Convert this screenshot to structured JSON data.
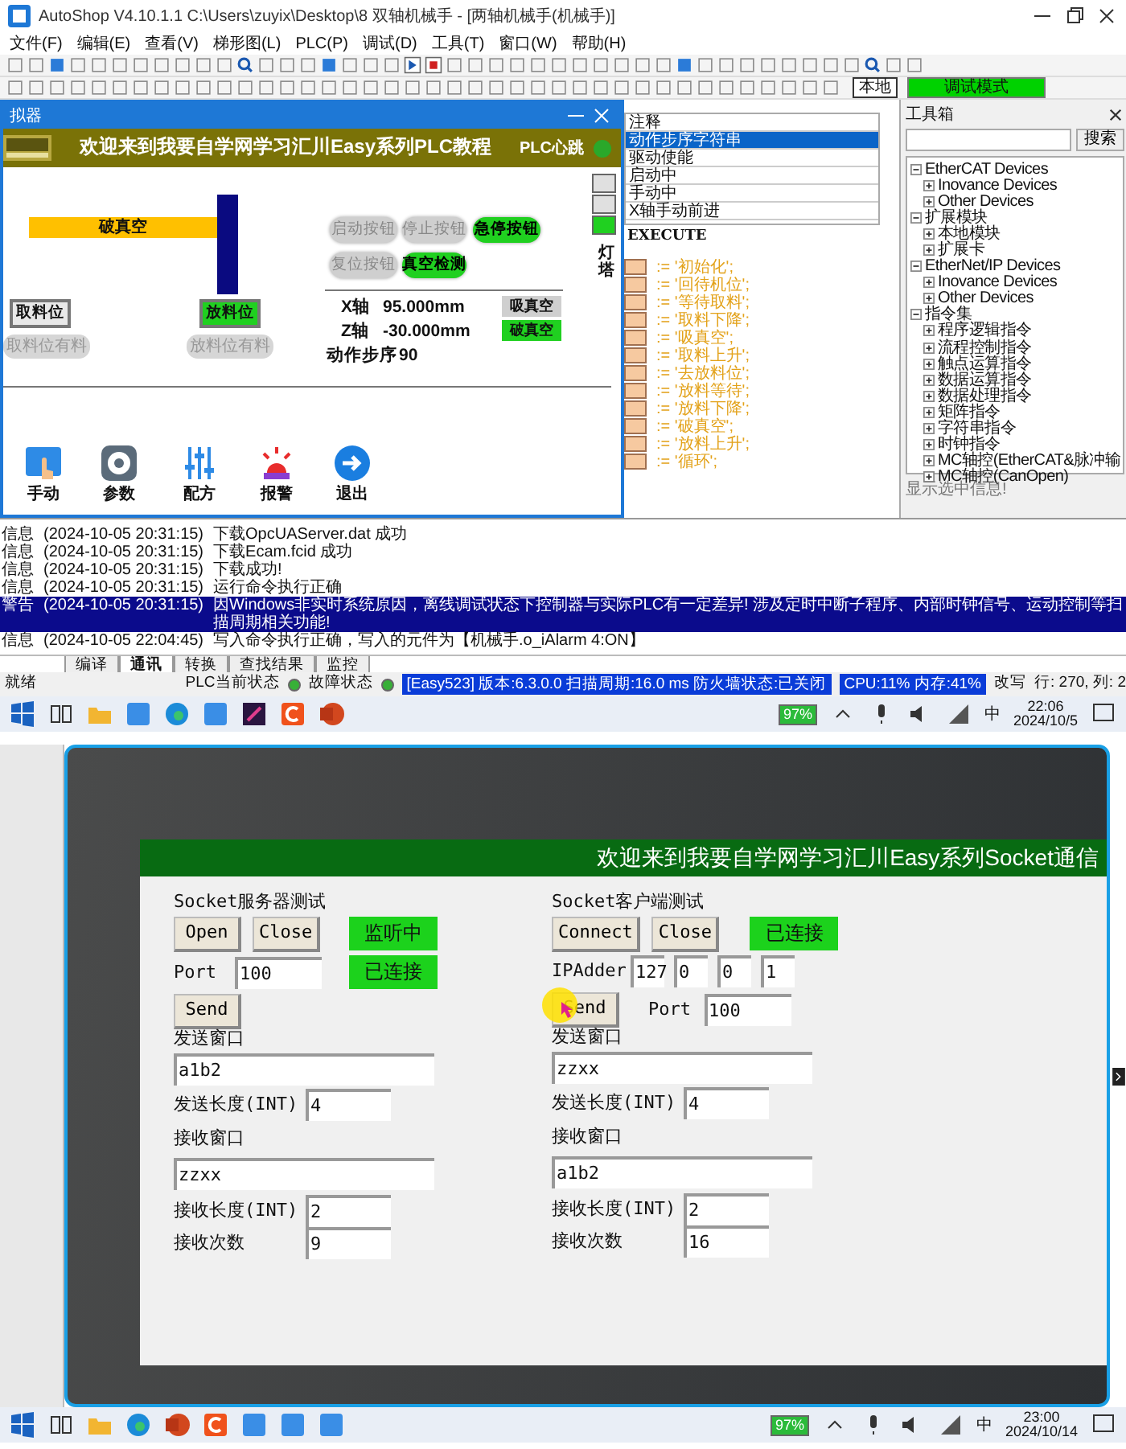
{
  "top": {
    "window": {
      "title": "AutoShop V4.10.1.1  C:\\Users\\zuyix\\Desktop\\8 双轴机械手 - [两轴机械手(机械手)]"
    },
    "menu": [
      "文件(F)",
      "编辑(E)",
      "查看(V)",
      "梯形图(L)",
      "PLC(P)",
      "调试(D)",
      "工具(T)",
      "窗口(W)",
      "帮助(H)"
    ],
    "toolbar": {
      "location": "本地",
      "mode": "调试模式"
    },
    "simulator": {
      "title": "拟器",
      "header": "欢迎来到我要自学网学习汇川Easy系列PLC教程",
      "heartbeat_label": "PLC心跳",
      "heartbeat_on": true,
      "vacuum_bar": "破真空",
      "buttons": [
        {
          "label": "启动按钮",
          "on": false
        },
        {
          "label": "停止按钮",
          "on": false
        },
        {
          "label": "急停按钮",
          "on": true
        },
        {
          "label": "复位按钮",
          "on": false
        },
        {
          "label": "真空检测",
          "on": true
        }
      ],
      "positions": [
        {
          "label": "取料位",
          "on": false
        },
        {
          "label": "放料位",
          "on": true
        }
      ],
      "sensors": [
        {
          "label": "取料位有料",
          "on": false
        },
        {
          "label": "放料位有料",
          "on": false
        }
      ],
      "axes": [
        {
          "label": "X轴",
          "value": "95.000mm"
        },
        {
          "label": "Z轴",
          "value": "-30.000mm"
        }
      ],
      "step": {
        "label": "动作步序",
        "value": "90"
      },
      "vacuum": [
        {
          "label": "吸真空",
          "on": false
        },
        {
          "label": "破真空",
          "on": true
        }
      ],
      "tower": {
        "label": "灯塔",
        "lamps": [
          {
            "on": false
          },
          {
            "on": false
          },
          {
            "on": true
          }
        ]
      },
      "nav": [
        {
          "label": "手动",
          "kind": "hand"
        },
        {
          "label": "参数",
          "kind": "gear"
        },
        {
          "label": "配方",
          "kind": "sliders"
        },
        {
          "label": "报警",
          "kind": "siren"
        },
        {
          "label": "退出",
          "kind": "exit"
        }
      ]
    },
    "variables": [
      {
        "text": "注释",
        "selected": false
      },
      {
        "text": "动作步序字符串",
        "selected": true
      },
      {
        "text": "驱动使能",
        "selected": false
      },
      {
        "text": "启动中",
        "selected": false
      },
      {
        "text": "手动中",
        "selected": false
      },
      {
        "text": "X轴手动前进",
        "selected": false
      }
    ],
    "code": {
      "label": "EXECUTE",
      "lines": [
        ":= '初始化';",
        ":= '回待机位';",
        ":= '等待取料';",
        ":= '取料下降';",
        ":= '吸真空';",
        ":= '取料上升';",
        ":= '去放料位';",
        ":= '放料等待';",
        ":= '放料下降';",
        ":= '破真空';",
        ":= '放料上升';",
        ":= '循环';"
      ]
    },
    "toolbox": {
      "title": "工具箱",
      "search_button": "搜索",
      "tree": [
        {
          "text": "EtherCAT Devices",
          "expanded": true,
          "children": [
            {
              "text": "Inovance Devices",
              "expanded": false
            },
            {
              "text": "Other Devices",
              "expanded": false
            }
          ]
        },
        {
          "text": "扩展模块",
          "expanded": true,
          "children": [
            {
              "text": "本地模块",
              "expanded": false
            },
            {
              "text": "扩展卡",
              "expanded": false
            }
          ]
        },
        {
          "text": "EtherNet/IP Devices",
          "expanded": true,
          "children": [
            {
              "text": "Inovance Devices",
              "expanded": false
            },
            {
              "text": "Other Devices",
              "expanded": false
            }
          ]
        },
        {
          "text": "指令集",
          "expanded": true,
          "children": [
            {
              "text": "程序逻辑指令",
              "expanded": false
            },
            {
              "text": "流程控制指令",
              "expanded": false
            },
            {
              "text": "触点运算指令",
              "expanded": false
            },
            {
              "text": "数据运算指令",
              "expanded": false
            },
            {
              "text": "数据处理指令",
              "expanded": false
            },
            {
              "text": "矩阵指令",
              "expanded": false
            },
            {
              "text": "字符串指令",
              "expanded": false
            },
            {
              "text": "时钟指令",
              "expanded": false
            },
            {
              "text": "MC轴控(EtherCAT&脉冲输",
              "expanded": false
            },
            {
              "text": "MC轴控(CanOpen)",
              "expanded": false
            }
          ]
        }
      ],
      "info": "显示选中信息!"
    },
    "log": {
      "lines": [
        {
          "type": "信息",
          "time": "(2024-10-05 20:31:15)",
          "message": "下载OpcUAServer.dat 成功",
          "selected": false
        },
        {
          "type": "信息",
          "time": "(2024-10-05 20:31:15)",
          "message": "下载Ecam.fcid 成功",
          "selected": false
        },
        {
          "type": "信息",
          "time": "(2024-10-05 20:31:15)",
          "message": "下载成功!",
          "selected": false
        },
        {
          "type": "信息",
          "time": "(2024-10-05 20:31:15)",
          "message": "运行命令执行正确",
          "selected": false
        },
        {
          "type": "警告",
          "time": "(2024-10-05 20:31:15)",
          "message": "因Windows非实时系统原因，离线调试状态下控制器与实际PLC有一定差异! 涉及定时中断子程序、内部时钟信号、运动控制等扫描周期相关功能!",
          "selected": true
        },
        {
          "type": "信息",
          "time": "(2024-10-05 22:04:45)",
          "message": "写入命令执行正确，写入的元件为【机械手.o_iAlarm 4:ON】",
          "selected": false
        }
      ],
      "tabs": [
        {
          "label": "编译",
          "selected": false
        },
        {
          "label": "通讯",
          "selected": true
        },
        {
          "label": "转换",
          "selected": false
        },
        {
          "label": "查找结果",
          "selected": false
        },
        {
          "label": "监控",
          "selected": false
        }
      ]
    },
    "status_bar": {
      "ready": "就绪",
      "plc_state": "PLC当前状态",
      "fault_state": "故障状态",
      "version": "[Easy523] 版本:6.3.0.0 扫描周期:16.0 ms 防火墙状态:已关闭",
      "usage": "CPU:11%  内存:41%",
      "mode": "改写",
      "position": "行: 270, 列:  2"
    },
    "taskbar": {
      "battery": "97%",
      "ime": "中",
      "time": "22:06",
      "date": "2024/10/5"
    }
  },
  "bottom": {
    "header": "欢迎来到我要自学网学习汇川Easy系列Socket通信",
    "columns": [
      {
        "kind": "server",
        "title": "Socket服务器测试",
        "buttons": [
          "Open",
          "Close"
        ],
        "status": [
          "监听中",
          "已连接"
        ],
        "port_label": "Port",
        "port": "100",
        "send_button": "Send",
        "send_label": "发送窗口",
        "send_text": "a1b2",
        "send_len_label": "发送长度(INT)",
        "send_len": "4",
        "recv_label": "接收窗口",
        "recv_text": "zzxx",
        "recv_len_label": "接收长度(INT)",
        "recv_len": "2",
        "recv_count_label": "接收次数",
        "recv_count": "9"
      },
      {
        "kind": "client",
        "title": "Socket客户端测试",
        "buttons": [
          "Connect",
          "Close"
        ],
        "status": [
          "已连接"
        ],
        "ip_label": "IPAdder",
        "ip": [
          "127",
          "0",
          "0",
          "1"
        ],
        "port_label": "Port",
        "port": "100",
        "send_button": "Send",
        "send_label": "发送窗口",
        "send_text": "zzxx",
        "send_len_label": "发送长度(INT)",
        "send_len": "4",
        "recv_label": "接收窗口",
        "recv_text": "a1b2",
        "recv_len_label": "接收长度(INT)",
        "recv_len": "2",
        "recv_count_label": "接收次数",
        "recv_count": "16"
      }
    ],
    "taskbar": {
      "battery": "97%",
      "ime": "中",
      "time": "23:00",
      "date": "2024/10/14"
    }
  }
}
